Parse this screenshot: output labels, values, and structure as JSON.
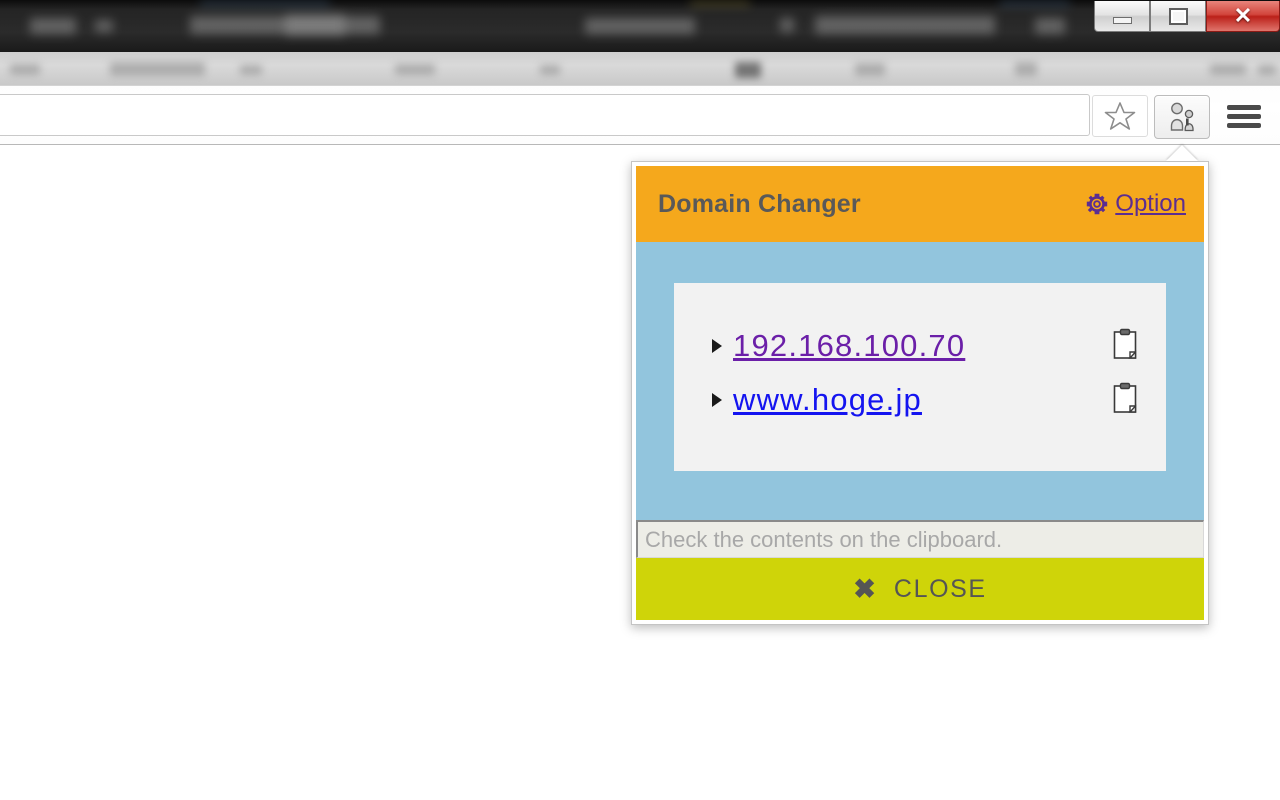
{
  "window": {
    "controls": {
      "minimize_label": "—",
      "restore_label": "❐",
      "close_label": "✕"
    }
  },
  "browser": {
    "toolbar": {
      "bookmark_icon": "star-icon",
      "extension_icon": "domain-changer-extension-icon",
      "menu_icon": "hamburger-menu-icon",
      "address_value": "",
      "address_placeholder": ""
    }
  },
  "popup": {
    "header": {
      "title": "Domain Changer",
      "option_label": "Option",
      "option_icon": "gear-icon",
      "background_color": "#F5A81C",
      "title_color": "#595959",
      "option_color": "#5C2D91"
    },
    "body": {
      "background_color": "#92C5DD",
      "panel_color": "#F2F2F2",
      "items": [
        {
          "label": "192.168.100.70",
          "state": "visited",
          "color": "#6B1FA8",
          "copy_icon": "clipboard-icon"
        },
        {
          "label": "www.hoge.jp",
          "state": "unvisited",
          "color": "#1414F0",
          "copy_icon": "clipboard-icon"
        }
      ]
    },
    "status": {
      "text": "Check the contents on the clipboard.",
      "text_color": "#A8A8A8",
      "background_color": "#EDEDE7"
    },
    "close_button": {
      "label": "CLOSE",
      "icon": "close-x-icon",
      "icon_glyph": "✖",
      "background_color": "#CFD409",
      "text_color": "#555555"
    }
  }
}
